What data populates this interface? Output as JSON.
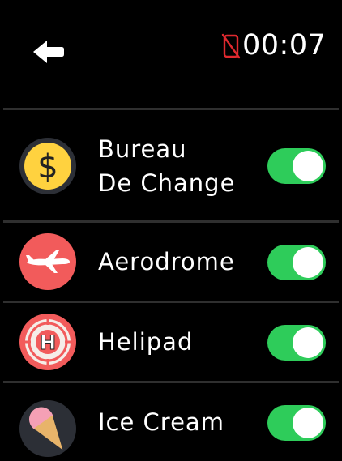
{
  "status_bar": {
    "time": "00:07",
    "back_icon": "back-arrow-icon",
    "connection_icon": "phone-disconnected-icon",
    "connection_color": "#e0292f"
  },
  "toggle_color": "#2ecc5a",
  "items": [
    {
      "label": "Bureau\nDe Change",
      "icon": "dollar-coin-icon",
      "icon_color": "#ffd23f",
      "enabled": true
    },
    {
      "label": "Aerodrome",
      "icon": "airplane-icon",
      "icon_color": "#f25b5b",
      "enabled": true
    },
    {
      "label": "Helipad",
      "icon": "helipad-icon",
      "icon_color": "#f25b5b",
      "enabled": true
    },
    {
      "label": "Ice Cream",
      "icon": "ice-cream-icon",
      "icon_color": "#f5a0b5",
      "enabled": true
    }
  ]
}
